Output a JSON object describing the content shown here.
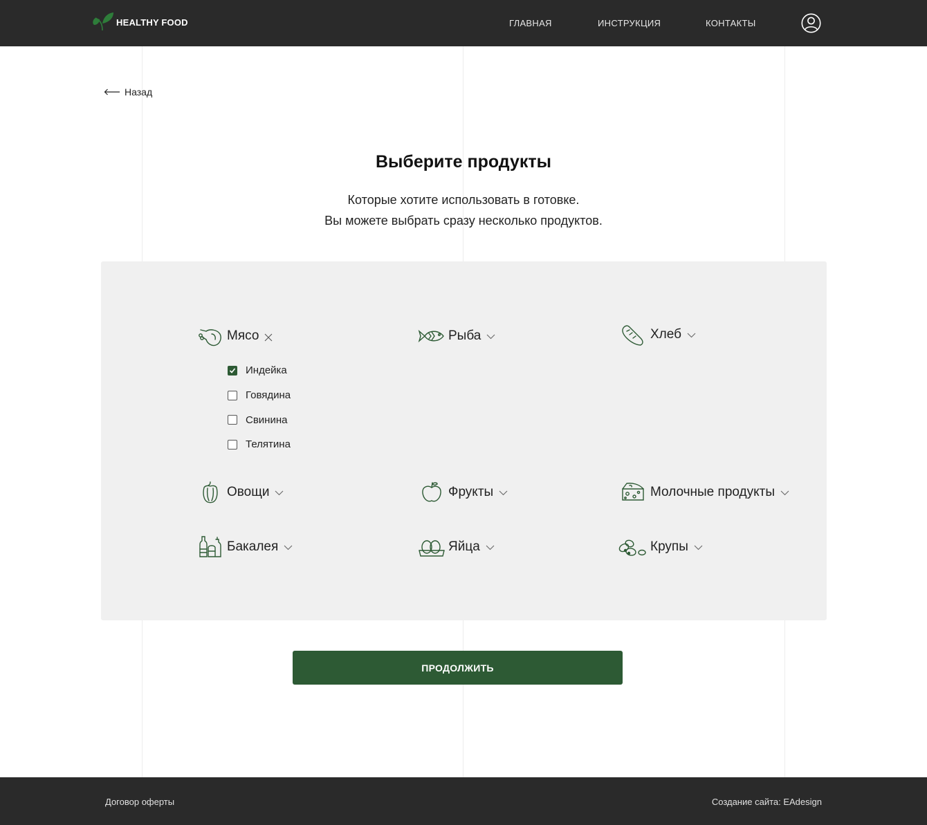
{
  "brand": {
    "name": "HEALTHY FOOD",
    "accent_color": "#2d5a34",
    "dark_color": "#2a2a2a",
    "panel_color": "#f0f0f0"
  },
  "nav": {
    "items": [
      {
        "label": "ГЛАВНАЯ"
      },
      {
        "label": "ИНСТРУКЦИЯ"
      },
      {
        "label": "КОНТАКТЫ"
      }
    ],
    "user_icon": "user-circle-icon"
  },
  "back": {
    "label": "Назад",
    "icon": "arrow-left-icon"
  },
  "title": "Выберите продукты",
  "subtitle": {
    "line1": "Которые хотите использовать в готовке.",
    "line2": "Вы можете выбрать сразу несколько продуктов."
  },
  "categories": [
    {
      "label": "Мясо",
      "icon": "drumstick-icon",
      "state": "expanded"
    },
    {
      "label": "Рыба",
      "icon": "fish-icon",
      "state": "collapsed"
    },
    {
      "label": "Хлеб",
      "icon": "bread-icon",
      "state": "collapsed"
    },
    {
      "label": "Овощи",
      "icon": "pepper-icon",
      "state": "collapsed"
    },
    {
      "label": "Фрукты",
      "icon": "apple-icon",
      "state": "collapsed"
    },
    {
      "label": "Молочные продукты",
      "icon": "cheese-icon",
      "state": "collapsed"
    },
    {
      "label": "Бакалея",
      "icon": "grocery-bottles-icon",
      "state": "collapsed"
    },
    {
      "label": "Яйца",
      "icon": "eggs-icon",
      "state": "collapsed"
    },
    {
      "label": "Крупы",
      "icon": "grains-icon",
      "state": "collapsed"
    }
  ],
  "meat_options": [
    {
      "label": "Индейка",
      "checked": true
    },
    {
      "label": "Говядина",
      "checked": false
    },
    {
      "label": "Свинина",
      "checked": false
    },
    {
      "label": "Телятина",
      "checked": false
    }
  ],
  "continue_label": "ПРОДОЛЖИТЬ",
  "footer": {
    "left": "Договор оферты",
    "right": "Создание сайта: EAdesign"
  }
}
